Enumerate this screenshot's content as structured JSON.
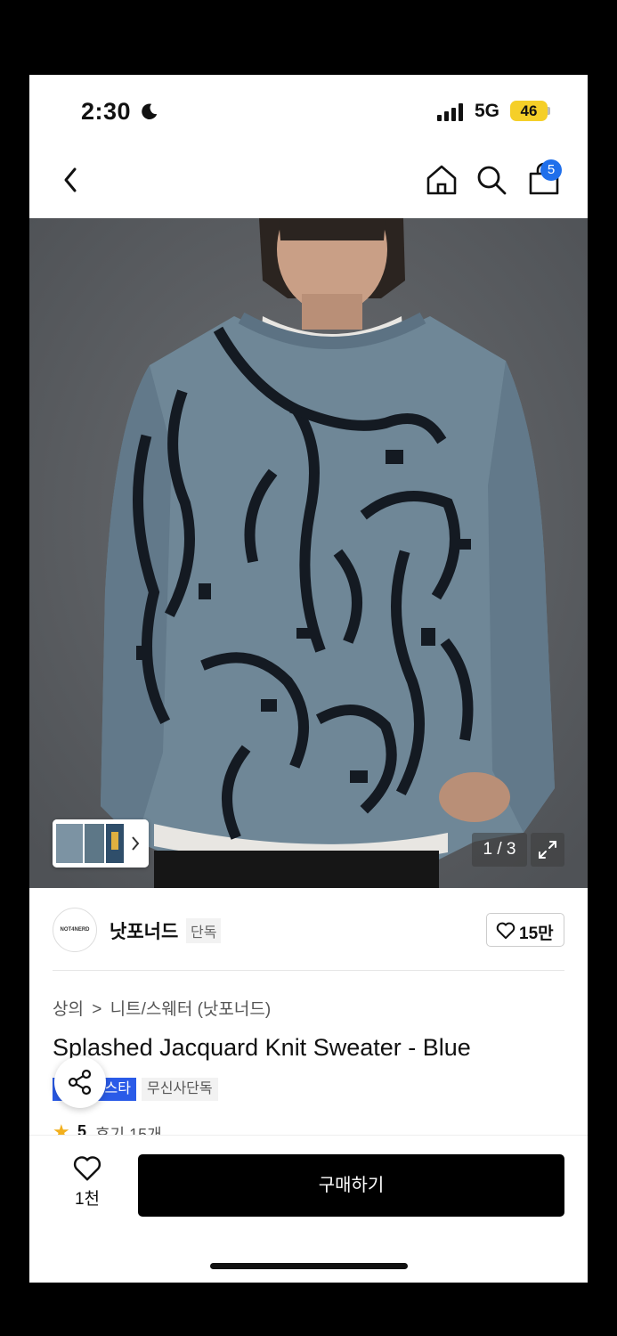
{
  "status_bar": {
    "time": "2:30",
    "network": "5G",
    "battery": "46"
  },
  "nav": {
    "cart_count": "5"
  },
  "gallery": {
    "counter": "1 / 3"
  },
  "brand": {
    "logo_text": "NOT4NERD",
    "name": "낫포너드",
    "tag": "단독",
    "likes": "15만"
  },
  "product": {
    "breadcrumb": [
      "상의",
      "니트/스웨터 (낫포너드)"
    ],
    "breadcrumb_separator": ">",
    "title": "Splashed Jacquard Knit Sweater - Blue",
    "badges": {
      "primary": "스타",
      "secondary": "무신사단독"
    },
    "rating": {
      "score": "5",
      "reviews": "후기 15개"
    }
  },
  "bottom_bar": {
    "wish_count": "1천",
    "buy_label": "구매하기"
  },
  "colors": {
    "accent_blue": "#2a5be8",
    "badge_blue": "#1f6feb",
    "buy_button": "#000000",
    "battery": "#f5cf28"
  },
  "icons": [
    "moon-icon",
    "signal-icon",
    "back-icon",
    "home-icon",
    "search-icon",
    "cart-icon",
    "expand-icon",
    "heart-icon",
    "share-icon",
    "star-icon"
  ]
}
